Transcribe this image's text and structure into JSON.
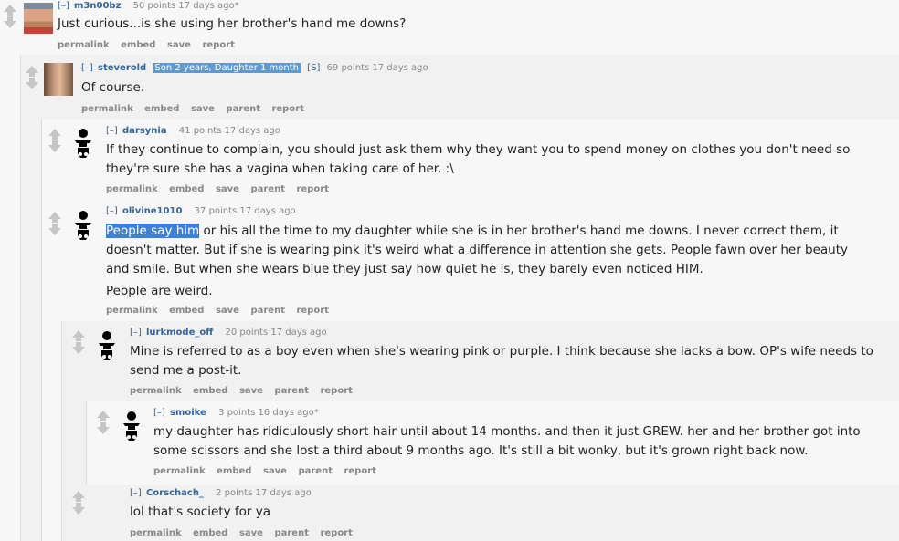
{
  "comments": [
    {
      "toggle": "[–]",
      "author": "m3n00bz",
      "points": "50 points 17 days ago*",
      "body": [
        "Just curious...is she using her brother's hand me downs?"
      ],
      "actions": [
        "permalink",
        "embed",
        "save",
        "report"
      ]
    },
    {
      "toggle": "[–]",
      "author": "steverold",
      "flair": "Son 2 years, Daughter 1 month",
      "mod_tag": "[S]",
      "points": "69 points 17 days ago",
      "body": [
        "Of course."
      ],
      "actions": [
        "permalink",
        "embed",
        "save",
        "parent",
        "report"
      ]
    },
    {
      "toggle": "[–]",
      "author": "darsynia",
      "points": "41 points 17 days ago",
      "body": [
        "If they continue to complain, you should just ask them why they want you to spend money on clothes you don't need so they're sure she has a vagina when taking care of her. :\\"
      ],
      "actions": [
        "permalink",
        "embed",
        "save",
        "parent",
        "report"
      ]
    },
    {
      "toggle": "[–]",
      "author": "olivine1010",
      "points": "37 points 17 days ago",
      "highlight": "People say him",
      "body_rest": " or his all the time to my daughter while she is in her brother's hand me downs. I never correct them, it doesn't matter. But if she is wearing pink it's weird what a difference in attention she gets. People fawn over her beauty and smile. But when she wears blue they just say how quiet he is, they barely even noticed HIM.",
      "body2": "People are weird.",
      "actions": [
        "permalink",
        "embed",
        "save",
        "parent",
        "report"
      ]
    },
    {
      "toggle": "[–]",
      "author": "lurkmode_off",
      "points": "20 points 17 days ago",
      "body": [
        "Mine is referred to as a boy even when she's wearing pink or purple. I think because she lacks a bow. OP's wife needs to send me a post-it."
      ],
      "actions": [
        "permalink",
        "embed",
        "save",
        "parent",
        "report"
      ]
    },
    {
      "toggle": "[–]",
      "author": "smoike",
      "points": "3 points 16 days ago*",
      "body": [
        "my daughter has ridiculously short hair until about 14 months. and then it just GREW. her and her brother got into some scissors and she lost a third about 9 months ago. It's still a bit wonky, but it's grown right back now."
      ],
      "actions": [
        "permalink",
        "embed",
        "save",
        "parent",
        "report"
      ]
    },
    {
      "toggle": "[–]",
      "author": "Corschach_",
      "points": "2 points 17 days ago",
      "body": [
        "lol that's society for ya"
      ],
      "actions": [
        "permalink",
        "embed",
        "save",
        "parent",
        "report"
      ]
    }
  ],
  "icons": {
    "upvote": "upvote-arrow-icon",
    "downvote": "downvote-arrow-icon",
    "baby_avatar": "baby-avatar-icon",
    "photo_avatar": "user-photo-avatar"
  }
}
